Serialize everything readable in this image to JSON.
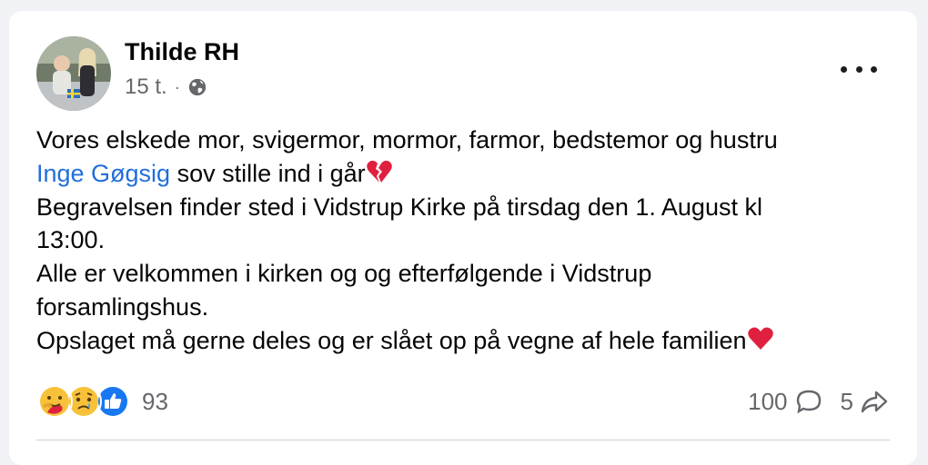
{
  "post": {
    "author": "Thilde RH",
    "time": "15 t.",
    "separator": "·",
    "privacy_icon": "globe-icon",
    "more_icon": "more-options-icon",
    "body": {
      "line1": "Vores elskede mor, svigermor, mormor, farmor, bedstemor og hustru",
      "mention": "Inge Gøgsig",
      "line2_rest": " sov stille ind i går",
      "line2_emoji": "broken-heart-emoji",
      "line3": "Begravelsen finder sted i Vidstrup Kirke på tirsdag den 1. August kl",
      "line4": "13:00.",
      "line5": "Alle er velkommen i kirken og og efterfølgende i Vidstrup",
      "line6": "forsamlingshus.",
      "line7": "Opslaget må gerne deles og er slået op på vegne af hele familien",
      "line7_emoji": "red-heart-emoji"
    }
  },
  "reactions": {
    "icons": [
      "care-reaction-icon",
      "sad-reaction-icon",
      "like-reaction-icon"
    ],
    "count": "93"
  },
  "stats": {
    "comments": "100",
    "comment_icon": "comment-icon",
    "shares": "5",
    "share_icon": "share-icon"
  },
  "colors": {
    "mention": "#216fdb",
    "secondary_text": "#65676b",
    "like_blue": "#1877f2",
    "reaction_yellow": "#f7c23a",
    "heart_red": "#e0203f"
  }
}
